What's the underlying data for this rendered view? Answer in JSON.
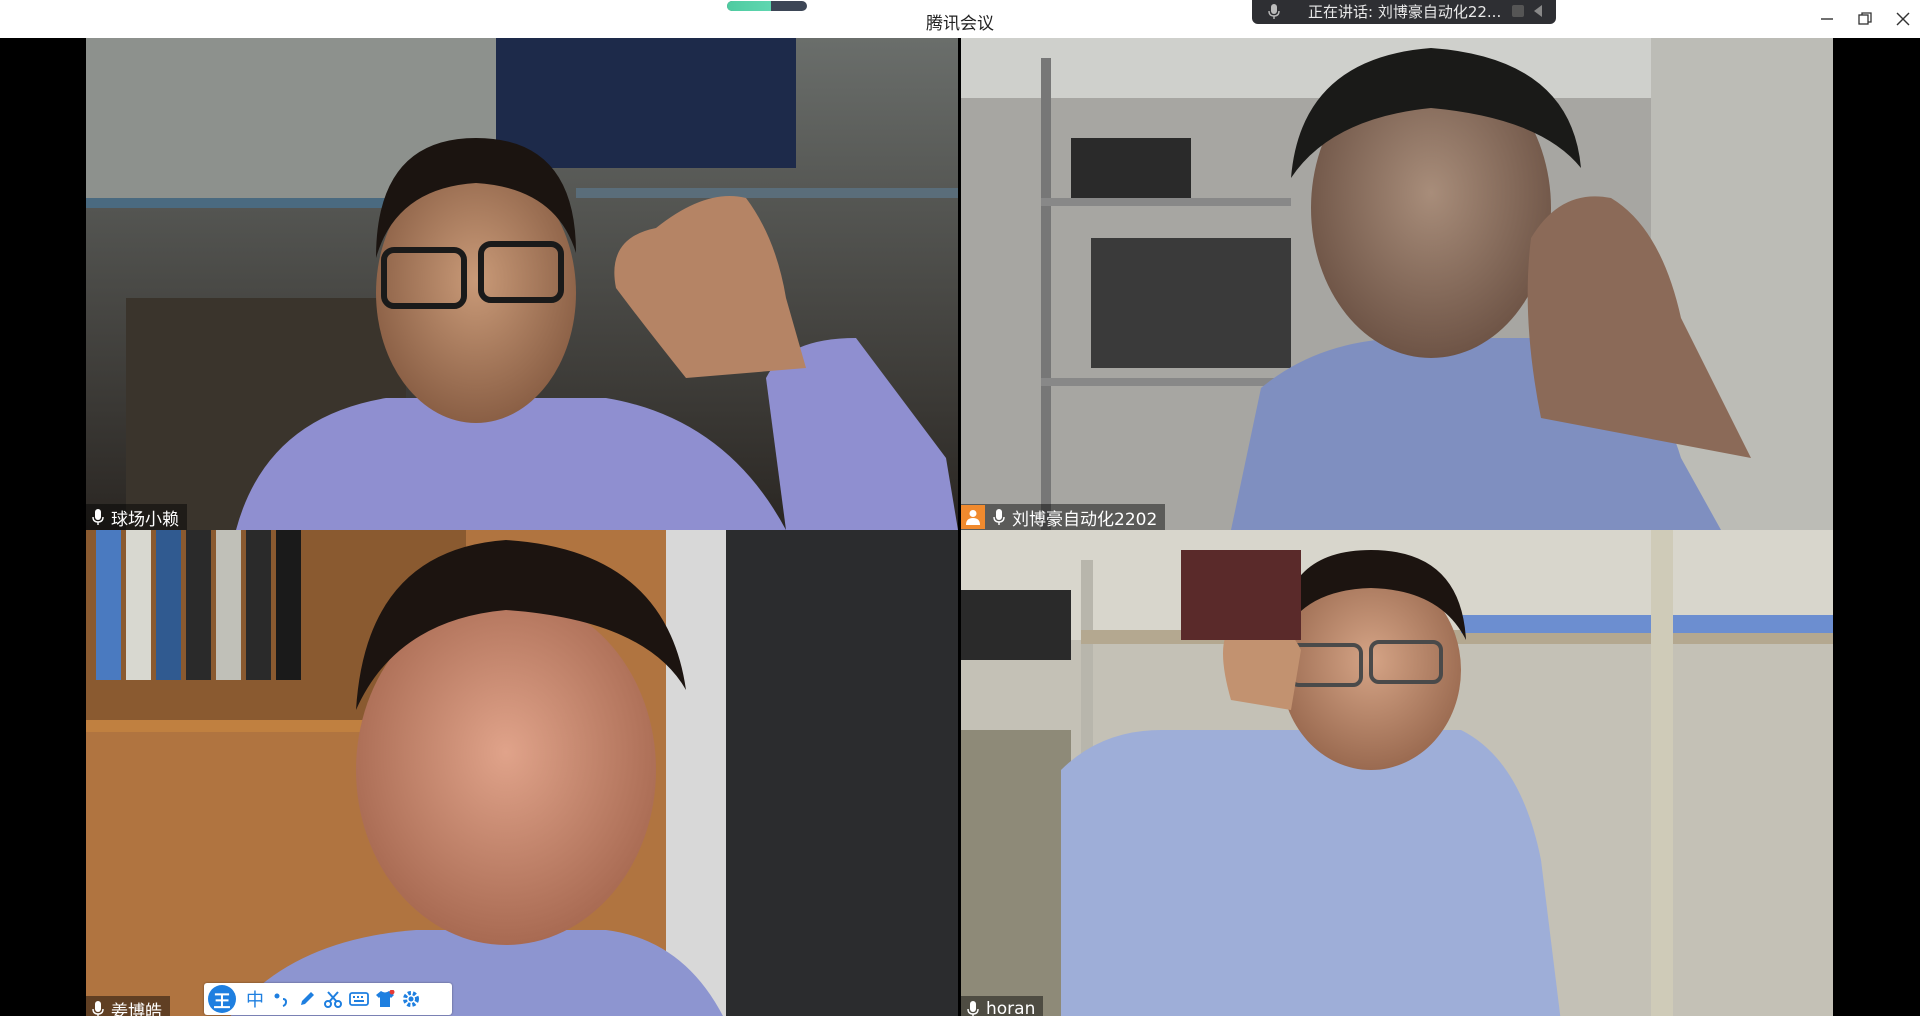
{
  "window": {
    "title": "腾讯会议",
    "buttons": [
      "minimize-icon",
      "restore-icon",
      "close-icon"
    ]
  },
  "network_indicator": {
    "level": 0.55,
    "color": "#4ecba0"
  },
  "speaking_banner": {
    "text": "正在讲话: 刘博豪自动化22..."
  },
  "participants": [
    {
      "name": "球场小赖",
      "mic": "mic-icon",
      "speaking": false,
      "host": false
    },
    {
      "name": "刘博豪自动化2202",
      "mic": "mic-icon",
      "speaking": true,
      "host": true
    },
    {
      "name": "姜博皓",
      "mic": "mic-icon",
      "speaking": false,
      "host": false
    },
    {
      "name": "horan",
      "mic": "mic-icon",
      "speaking": false,
      "host": false
    }
  ],
  "ime_toolbar": {
    "logo": "王",
    "mode": "中",
    "items": [
      "punctuation-icon",
      "pen-icon",
      "scissors-icon",
      "keyboard-icon",
      "skin-icon",
      "settings-icon"
    ]
  },
  "colors": {
    "active_border": "#3bd58a",
    "host_badge": "#f08a2e",
    "ime_accent": "#1e7fe0"
  }
}
